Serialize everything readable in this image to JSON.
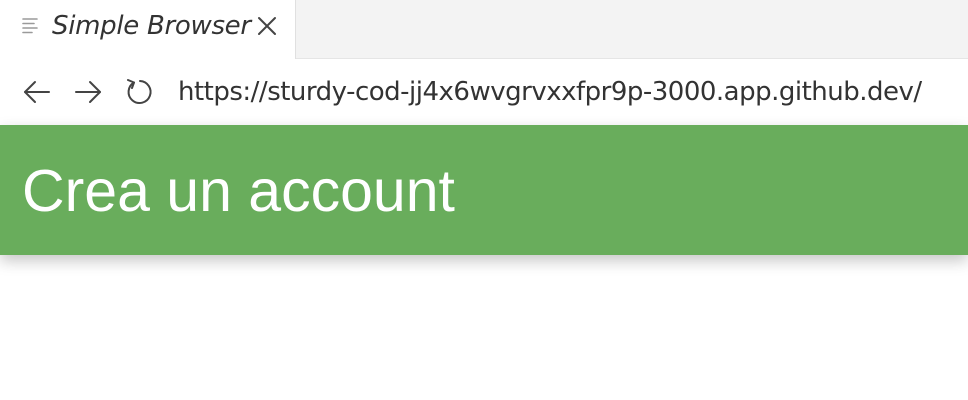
{
  "tab": {
    "title": "Simple Browser",
    "icon": "document-lines-icon",
    "close_icon": "close-icon"
  },
  "navbar": {
    "back_icon": "arrow-left-icon",
    "forward_icon": "arrow-right-icon",
    "reload_icon": "reload-icon",
    "url": "https://sturdy-cod-jj4x6wvgrvxxfpr9p-3000.app.github.dev/"
  },
  "page": {
    "header_title": "Crea un account",
    "header_color": "#69ad5c"
  }
}
